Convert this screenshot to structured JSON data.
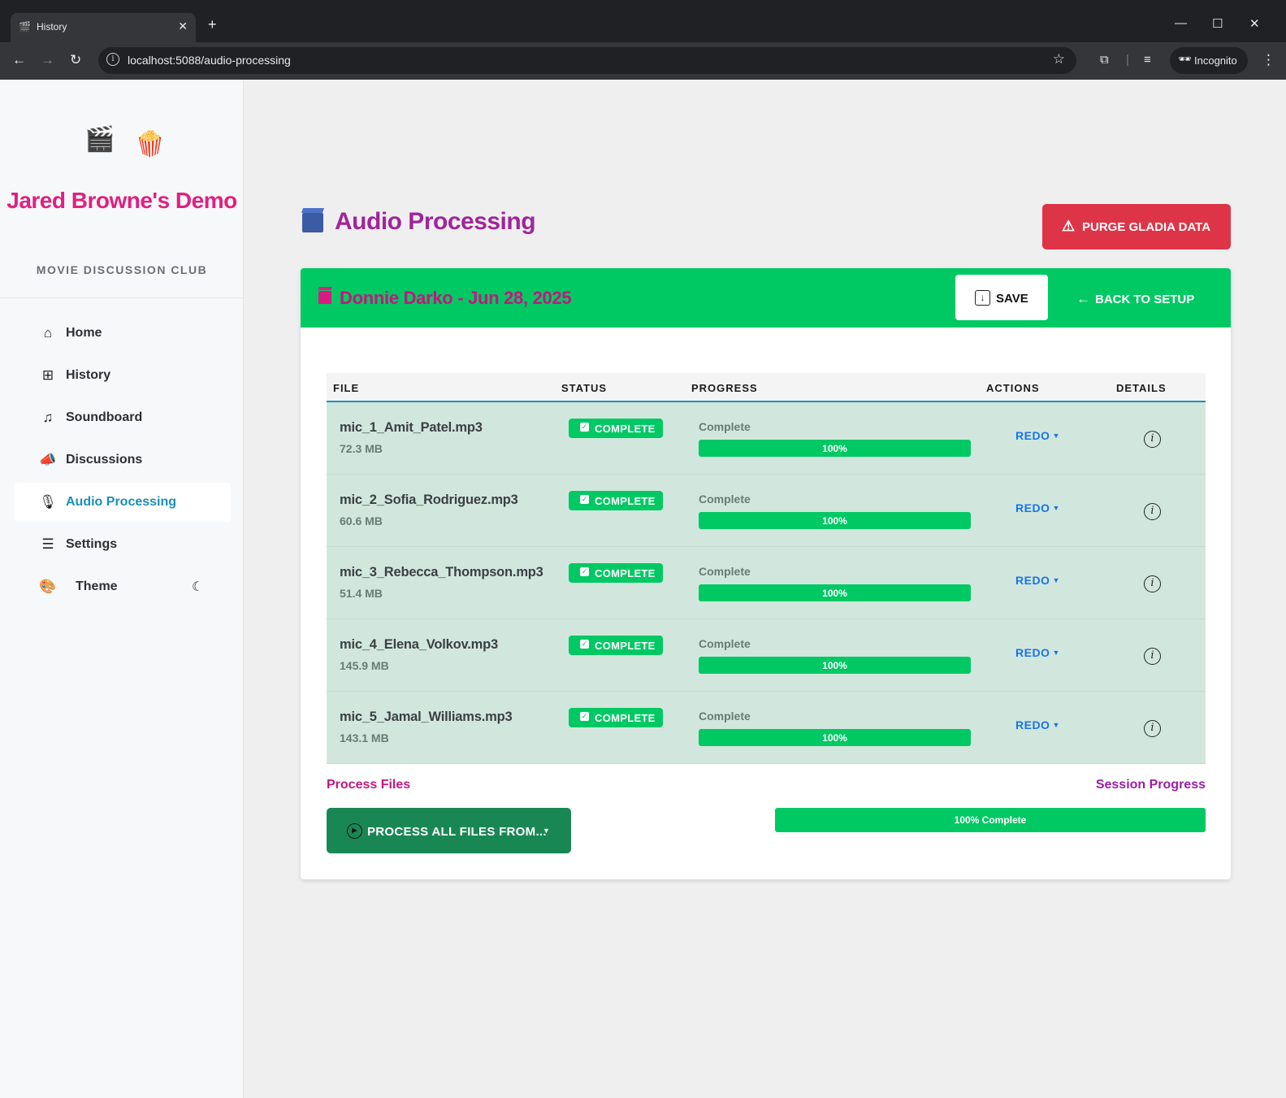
{
  "browser": {
    "tab_title": "History",
    "url": "localhost:5088/audio-processing",
    "incognito_label": "Incognito"
  },
  "sidebar": {
    "brand": "Jared Browne's Demo",
    "subtitle": "MOVIE DISCUSSION CLUB",
    "items": [
      {
        "label": "Home",
        "icon": "home-icon"
      },
      {
        "label": "History",
        "icon": "plus-square-icon"
      },
      {
        "label": "Soundboard",
        "icon": "music-note-icon"
      },
      {
        "label": "Discussions",
        "icon": "megaphone-icon"
      },
      {
        "label": "Audio Processing",
        "icon": "microphone-icon",
        "active": true
      },
      {
        "label": "Settings",
        "icon": "sliders-icon"
      }
    ],
    "theme_label": "Theme"
  },
  "main": {
    "title": "Audio Processing",
    "purge_label": "PURGE GLADIA DATA",
    "session_title": "Donnie Darko - Jun 28, 2025",
    "save_label": "SAVE",
    "back_label": "BACK TO SETUP",
    "table": {
      "headers": [
        "FILE",
        "STATUS",
        "PROGRESS",
        "ACTIONS",
        "DETAILS"
      ],
      "rows": [
        {
          "file": "mic_1_Amit_Patel.mp3",
          "size": "72.3 MB",
          "status": "COMPLETE",
          "progress_text": "Complete",
          "progress": 100,
          "progress_label": "100%",
          "action": "REDO"
        },
        {
          "file": "mic_2_Sofia_Rodriguez.mp3",
          "size": "60.6 MB",
          "status": "COMPLETE",
          "progress_text": "Complete",
          "progress": 100,
          "progress_label": "100%",
          "action": "REDO"
        },
        {
          "file": "mic_3_Rebecca_Thompson.mp3",
          "size": "51.4 MB",
          "status": "COMPLETE",
          "progress_text": "Complete",
          "progress": 100,
          "progress_label": "100%",
          "action": "REDO"
        },
        {
          "file": "mic_4_Elena_Volkov.mp3",
          "size": "145.9 MB",
          "status": "COMPLETE",
          "progress_text": "Complete",
          "progress": 100,
          "progress_label": "100%",
          "action": "REDO"
        },
        {
          "file": "mic_5_Jamal_Williams.mp3",
          "size": "143.1 MB",
          "status": "COMPLETE",
          "progress_text": "Complete",
          "progress": 100,
          "progress_label": "100%",
          "action": "REDO"
        }
      ]
    },
    "process_files_label": "Process Files",
    "process_button_label": "PROCESS ALL FILES FROM...",
    "session_progress_label": "Session Progress",
    "session_progress": 100,
    "session_progress_text": "100% Complete"
  },
  "colors": {
    "accent_green": "#00c964",
    "purge_red": "#de3447",
    "title_purple": "#a0259a",
    "brand_pink": "#e0207f",
    "active_blue": "#1a8fb8",
    "process_green": "#198754"
  }
}
